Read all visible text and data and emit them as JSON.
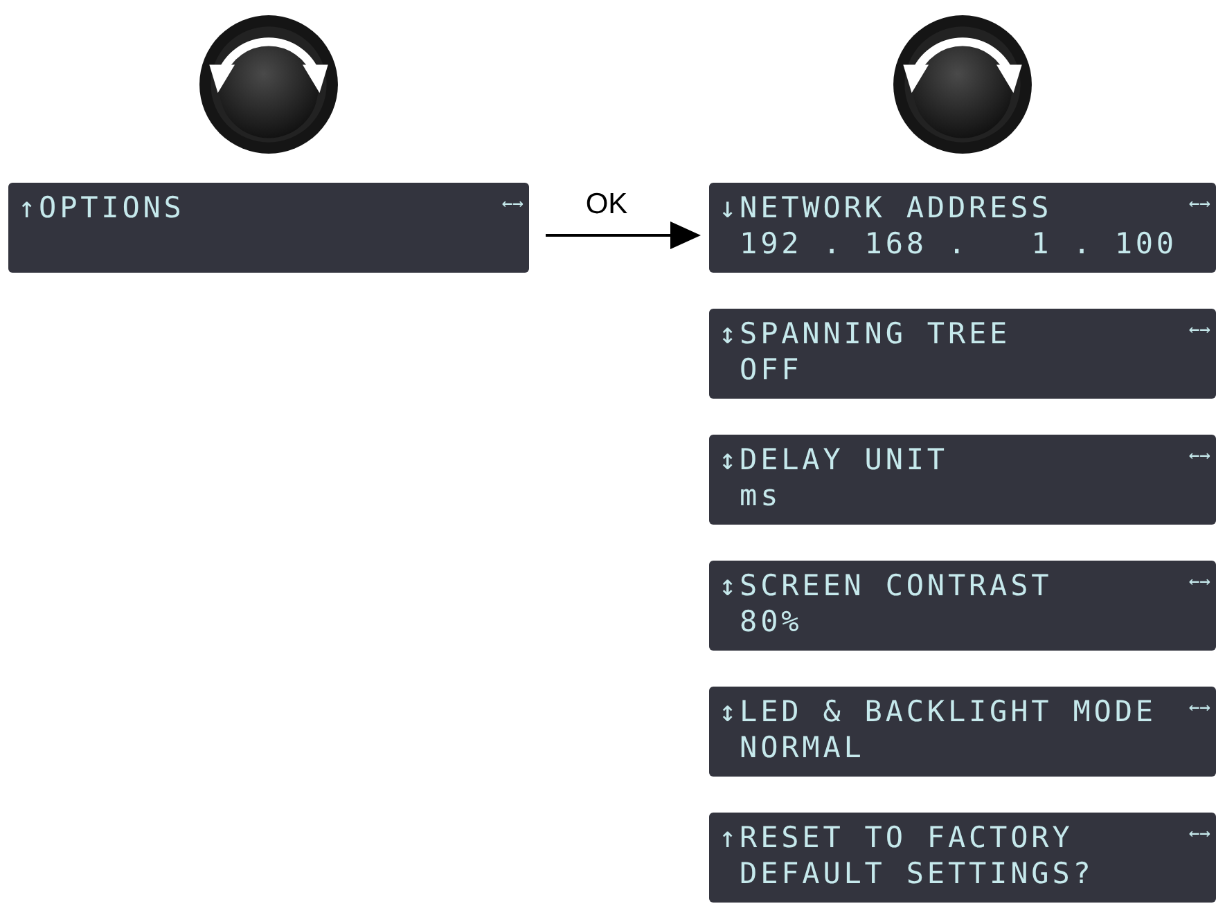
{
  "columns": [
    {
      "screens": [
        {
          "lines": [
            "↑OPTIONS"
          ],
          "nav_hint": "←→"
        }
      ]
    },
    {
      "screens": [
        {
          "lines": [
            "↓NETWORK ADDRESS",
            " 192 . 168 .   1 . 100"
          ],
          "nav_hint": "←→"
        },
        {
          "lines": [
            "↕SPANNING TREE",
            " OFF"
          ],
          "nav_hint": "←→"
        },
        {
          "lines": [
            "↕DELAY UNIT",
            " ms"
          ],
          "nav_hint": "←→"
        },
        {
          "lines": [
            "↕SCREEN CONTRAST",
            " 80%"
          ],
          "nav_hint": "←→"
        },
        {
          "lines": [
            "↕LED & BACKLIGHT MODE",
            " NORMAL"
          ],
          "nav_hint": "←→"
        },
        {
          "lines": [
            "↑RESET TO FACTORY",
            " DEFAULT SETTINGS?"
          ],
          "nav_hint": "←→"
        }
      ]
    }
  ],
  "transition": {
    "label": "OK"
  }
}
